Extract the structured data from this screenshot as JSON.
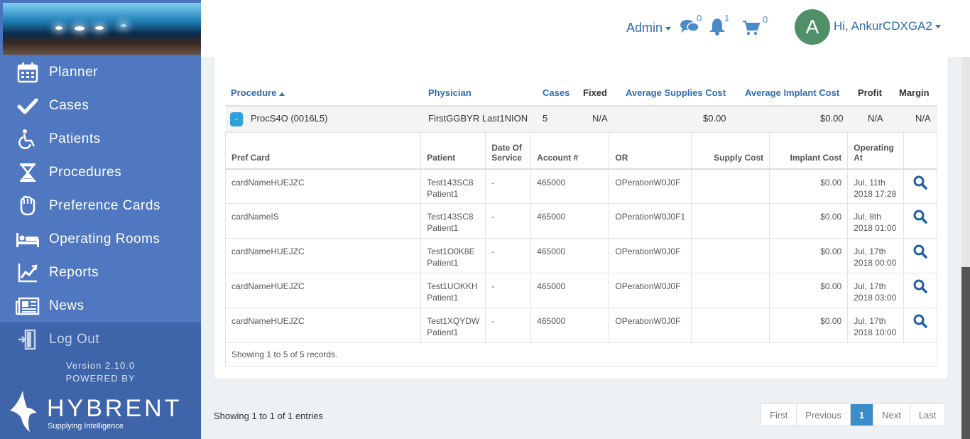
{
  "header": {
    "admin_label": "Admin",
    "chat_count": "0",
    "bell_count": "1",
    "cart_count": "0",
    "avatar_letter": "A",
    "greeting": "Hi, AnkurCDXGA2"
  },
  "sidebar": {
    "items": [
      {
        "label": "Planner",
        "icon": "calendar-icon"
      },
      {
        "label": "Cases",
        "icon": "checkmark-icon"
      },
      {
        "label": "Patients",
        "icon": "wheelchair-icon"
      },
      {
        "label": "Procedures",
        "icon": "hourglass-icon"
      },
      {
        "label": "Preference Cards",
        "icon": "glove-icon"
      },
      {
        "label": "Operating Rooms",
        "icon": "bed-icon"
      },
      {
        "label": "Reports",
        "icon": "line-chart-icon"
      },
      {
        "label": "News",
        "icon": "newspaper-icon"
      }
    ],
    "logout_label": "Log Out",
    "version": "Version 2.10.0",
    "powered_by": "POWERED BY",
    "brand_name": "HYBRENT",
    "brand_tagline": "Supplying Intelligence"
  },
  "table": {
    "headers": {
      "procedure": "Procedure",
      "physician": "Physician",
      "cases": "Cases",
      "fixed": "Fixed",
      "avg_supplies": "Average Supplies Cost",
      "avg_implant": "Average Implant Cost",
      "profit": "Profit",
      "margin": "Margin"
    },
    "row": {
      "toggle": "-",
      "procedure": "ProcS4O (0016L5)",
      "physician": "FirstGGBYR Last1NION",
      "cases": "5",
      "fixed": "N/A",
      "avg_supplies": "$0.00",
      "avg_implant": "$0.00",
      "profit": "N/A",
      "margin": "N/A"
    }
  },
  "subtable": {
    "headers": {
      "pref_card": "Pref Card",
      "patient": "Patient",
      "dos_line1": "Date Of",
      "dos_line2": "Service",
      "account": "Account #",
      "or": "OR",
      "supply_cost": "Supply Cost",
      "implant_cost": "Implant Cost",
      "op_line1": "Operating",
      "op_line2": "At"
    },
    "rows": [
      {
        "pref_card": "cardNameHUEJZC",
        "patient1": "Test143SC8",
        "patient2": "Patient1",
        "dos": "-",
        "account": "465000",
        "or": "OPerationW0J0F",
        "supply_cost": "",
        "implant_cost": "$0.00",
        "op1": "Jul, 11th",
        "op2": "2018 17:28"
      },
      {
        "pref_card": "cardNameIS",
        "patient1": "Test143SC8",
        "patient2": "Patient1",
        "dos": "-",
        "account": "465000",
        "or": "OPerationW0J0F1",
        "supply_cost": "",
        "implant_cost": "$0.00",
        "op1": "Jul, 8th",
        "op2": "2018 01:00"
      },
      {
        "pref_card": "cardNameHUEJZC",
        "patient1": "Test1O0K8E",
        "patient2": "Patient1",
        "dos": "-",
        "account": "465000",
        "or": "OPerationW0J0F",
        "supply_cost": "",
        "implant_cost": "$0.00",
        "op1": "Jul, 17th",
        "op2": "2018 00:00"
      },
      {
        "pref_card": "cardNameHUEJZC",
        "patient1": "Test1UOKKH",
        "patient2": "Patient1",
        "dos": "-",
        "account": "465000",
        "or": "OPerationW0J0F",
        "supply_cost": "",
        "implant_cost": "$0.00",
        "op1": "Jul, 17th",
        "op2": "2018 03:00"
      },
      {
        "pref_card": "cardNameHUEJZC",
        "patient1": "Test1XQYDW",
        "patient2": "Patient1",
        "dos": "-",
        "account": "465000",
        "or": "OPerationW0J0F",
        "supply_cost": "",
        "implant_cost": "$0.00",
        "op1": "Jul, 17th",
        "op2": "2018 10:00"
      }
    ],
    "footer": "Showing 1 to 5 of 5 records."
  },
  "entries_text": "Showing 1 to 1 of 1 entries",
  "pagination": {
    "first": "First",
    "previous": "Previous",
    "current": "1",
    "next": "Next",
    "last": "Last"
  },
  "colors": {
    "sidebar": "#4a74bd",
    "accent": "#2f6db0",
    "active_page": "#3c8dcb",
    "avatar": "#4f9068"
  }
}
